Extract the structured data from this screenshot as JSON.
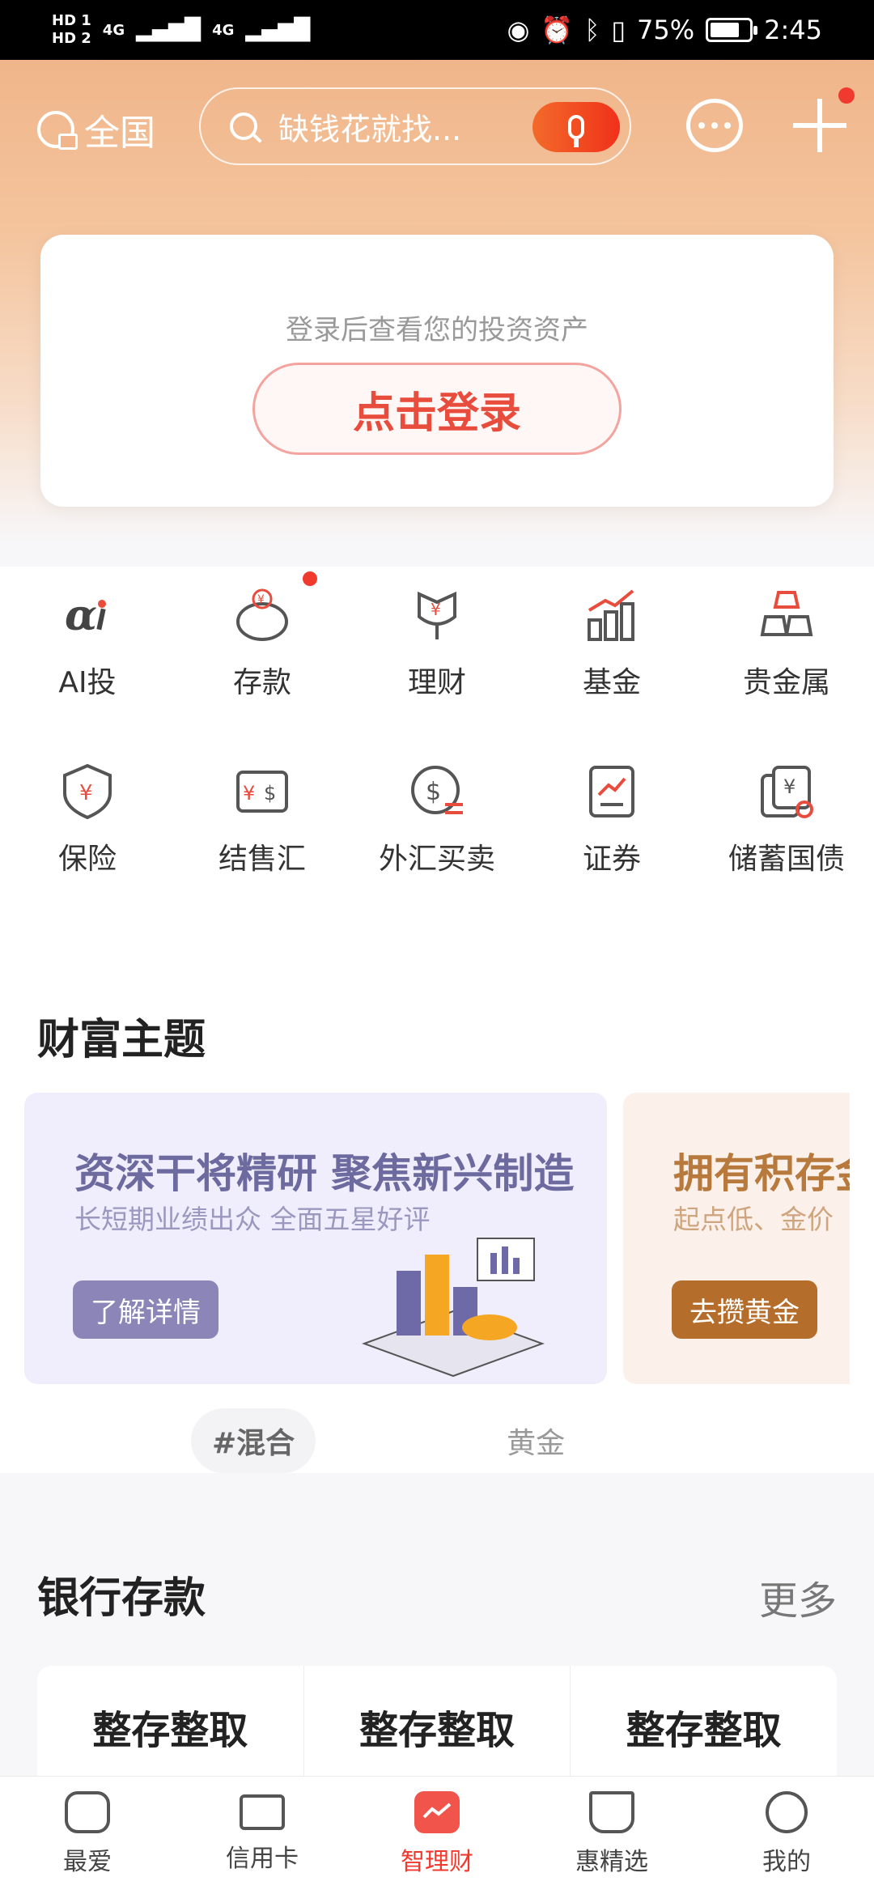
{
  "status_bar": {
    "hd1": "HD 1",
    "hd2": "HD 2",
    "signal1": "4G",
    "signal2": "4G",
    "battery_percent": "75%",
    "battery_level": 0.75,
    "time": "2:45"
  },
  "header": {
    "location": "全国",
    "search_placeholder": "缺钱花就找...",
    "icons": [
      "location-icon",
      "search-icon",
      "mic-icon",
      "message-icon",
      "plus-icon"
    ]
  },
  "login_card": {
    "hint": "登录后查看您的投资资产",
    "button": "点击登录"
  },
  "grid": {
    "items": [
      {
        "label": "AI投",
        "icon": "ai-icon"
      },
      {
        "label": "存款",
        "icon": "piggy-bank-icon"
      },
      {
        "label": "理财",
        "icon": "flower-yuan-icon"
      },
      {
        "label": "基金",
        "icon": "bar-chart-icon"
      },
      {
        "label": "贵金属",
        "icon": "gold-bars-icon"
      },
      {
        "label": "保险",
        "icon": "shield-icon"
      },
      {
        "label": "结售汇",
        "icon": "exchange-icon"
      },
      {
        "label": "外汇买卖",
        "icon": "dollar-icon"
      },
      {
        "label": "证券",
        "icon": "stock-icon"
      },
      {
        "label": "储蓄国债",
        "icon": "bond-icon"
      }
    ]
  },
  "wealth_theme": {
    "title": "财富主题",
    "card1": {
      "title": "资深干将精研 聚焦新兴制造",
      "subtitle": "长短期业绩出众 全面五星好评",
      "button": "了解详情"
    },
    "card2": {
      "title": "拥有积存金",
      "subtitle": "起点低、金价",
      "button": "去攒黄金"
    },
    "tags": {
      "active": "#混合",
      "other": "黄金"
    }
  },
  "bank_deposits": {
    "title": "银行存款",
    "more": "更多",
    "items": [
      "整存整取",
      "整存整取",
      "整存整取"
    ]
  },
  "bottom_nav": {
    "items": [
      {
        "label": "最爱",
        "icon": "favorite-icon"
      },
      {
        "label": "信用卡",
        "icon": "credit-card-icon"
      },
      {
        "label": "智理财",
        "icon": "wealth-icon"
      },
      {
        "label": "惠精选",
        "icon": "cup-icon"
      },
      {
        "label": "我的",
        "icon": "profile-icon"
      }
    ],
    "active_index": 2
  },
  "colors": {
    "accent": "#f03a2f",
    "header_gradient_top": "#f0b58a",
    "theme_card1_bg": "#f0eefc",
    "theme_card2_bg": "#fbf1ea"
  }
}
